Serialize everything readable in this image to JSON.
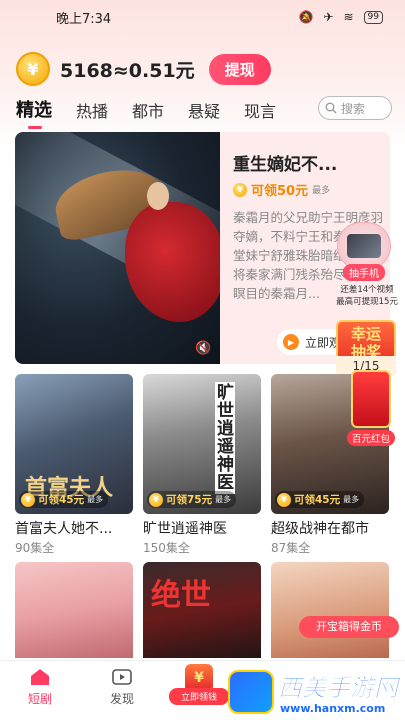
{
  "status_bar": {
    "time": "晚上7:34",
    "battery": "99"
  },
  "wallet": {
    "coin_symbol": "¥",
    "balance": "5168≈0.51元",
    "withdraw_label": "提现"
  },
  "tabs": [
    {
      "label": "精选",
      "active": true
    },
    {
      "label": "热播",
      "active": false
    },
    {
      "label": "都市",
      "active": false
    },
    {
      "label": "悬疑",
      "active": false
    },
    {
      "label": "现言",
      "active": false
    }
  ],
  "search": {
    "placeholder": "搜索"
  },
  "featured": {
    "title": "重生嫡妃不...",
    "reward": "可领50元",
    "reward_max": "最多",
    "description": "秦霜月的父兄助宁王明彦羽夺嫡，不料宁王和秦霜月的堂妹宁舒雅珠胎暗结，联手将秦家满门残杀殆尽，死不瞑目的秦霜月...",
    "watch_label": "立即观看"
  },
  "promo": {
    "phone_label": "抽手机",
    "video_hint_line1": "还差14个视频",
    "video_hint_line2": "最高可提现15元",
    "lucky_label_line1": "幸运",
    "lucky_label_line2": "抽奖",
    "lucky_count": "1/15",
    "hongbao_label": "百元红包",
    "treasure_label": "开宝箱得金币"
  },
  "dramas": [
    {
      "name": "首富夫人她不...",
      "episodes": "90集全",
      "reward": "可领45元",
      "reward_max": "最多"
    },
    {
      "name": "旷世逍遥神医",
      "episodes": "150集全",
      "reward": "可领75元",
      "reward_max": "最多"
    },
    {
      "name": "超级战神在都市",
      "episodes": "87集全",
      "reward": "可领45元",
      "reward_max": "最多"
    }
  ],
  "nav": {
    "items": [
      {
        "label": "短剧",
        "active": true
      },
      {
        "label": "发现",
        "active": false
      }
    ],
    "center_label": "立即领钱",
    "center_symbol": "¥"
  },
  "watermark": {
    "title": "西美手游网",
    "url": "www.hanxm.com"
  },
  "colors": {
    "accent": "#ff3b61",
    "gold": "#f5a700",
    "reward_orange": "#f08a00"
  }
}
